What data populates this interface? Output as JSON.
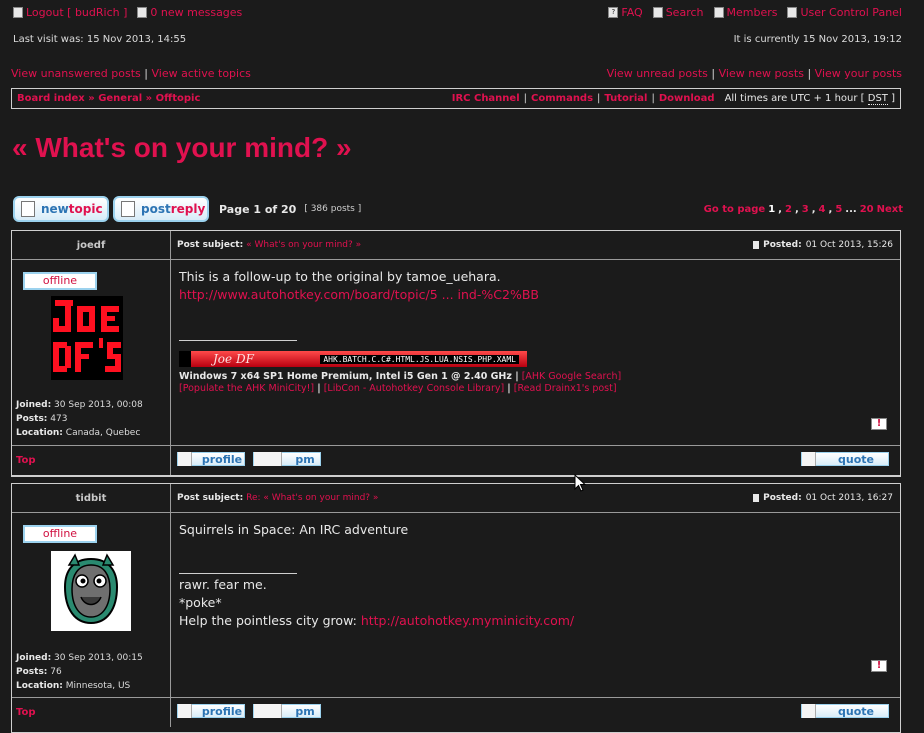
{
  "topbar": {
    "logout": "Logout [ budRich ]",
    "messages": "0 new messages",
    "faq": "FAQ",
    "search": "Search",
    "members": "Members",
    "ucp": "User Control Panel"
  },
  "visit": {
    "last_visit": "Last visit was: 15 Nov 2013, 14:55",
    "current": "It is currently 15 Nov 2013, 19:12"
  },
  "views": {
    "unanswered": "View unanswered posts",
    "active": "View active topics",
    "unread": "View unread posts",
    "new": "View new posts",
    "yours": "View your posts",
    "sep": "|"
  },
  "nav": {
    "breadcrumb": [
      "Board index",
      "General",
      "Offtopic"
    ],
    "breadcrumb_sep": "»",
    "links": [
      "IRC Channel",
      "Commands",
      "Tutorial",
      "Download"
    ],
    "timezone_prefix": "All times are UTC + 1 hour [",
    "dst": "DST",
    "timezone_suffix": "]"
  },
  "topic": {
    "title": "« What's on your mind? »"
  },
  "actions": {
    "new_topic": [
      "new",
      "topic"
    ],
    "post_reply": [
      "post",
      "reply"
    ],
    "page": "Page 1 of 20",
    "posts": "[ 386 posts ]",
    "goto": "Go to page",
    "pages": [
      "1",
      ",",
      "2",
      ",",
      "3",
      ",",
      "4",
      ",",
      "5",
      "...",
      "20",
      "Next"
    ]
  },
  "labels": {
    "post_subject": "Post subject:",
    "posted": "Posted:",
    "offline": "offline",
    "joined": "Joined:",
    "posts": "Posts:",
    "location": "Location:",
    "top": "Top",
    "profile": "profile",
    "pm": "pm",
    "quote": "quote",
    "report_icon": "!"
  },
  "posts": [
    {
      "author": "joedf",
      "subject": "« What's on your mind? »",
      "date": "01 Oct 2013, 15:26",
      "joined": "30 Sep 2013, 00:08",
      "post_count": "473",
      "location": "Canada, Quebec",
      "avatar_text": "JOE DF'S",
      "body_line1": "This is a follow-up to the original by tamoe_uehara.",
      "body_link": "http://www.autohotkey.com/board/topic/5 ... ind-%C2%BB",
      "sig_banner_name": "Joe DF",
      "sig_banner_tags": "AHK.BATCH.C.C#.HTML.JS.LUA.NSIS.PHP.XAML",
      "sig_specs": "Windows 7 x64 SP1 Home Premium, Intel i5 Gen 1 @ 2.40 GHz |",
      "sig_link1": "[AHK Google Search]",
      "sig_link2": "[Populate the AHK MiniCity!]",
      "sig_link3": "[LibCon - Autohotkey Console Library]",
      "sig_link4": "[Read Drainx1's post]",
      "sig_sep": "|"
    },
    {
      "author": "tidbit",
      "subject_prefix": "Re:",
      "subject": "« What's on your mind? »",
      "date": "01 Oct 2013, 16:27",
      "joined": "30 Sep 2013, 00:15",
      "post_count": "76",
      "location": "Minnesota, US",
      "body_line1": "Squirrels in Space: An IRC adventure",
      "sig_line1": "rawr. fear me.",
      "sig_line2": "*poke*",
      "sig_line3": "Help the pointless city grow:",
      "sig_link": "http://autohotkey.myminicity.com/"
    }
  ]
}
